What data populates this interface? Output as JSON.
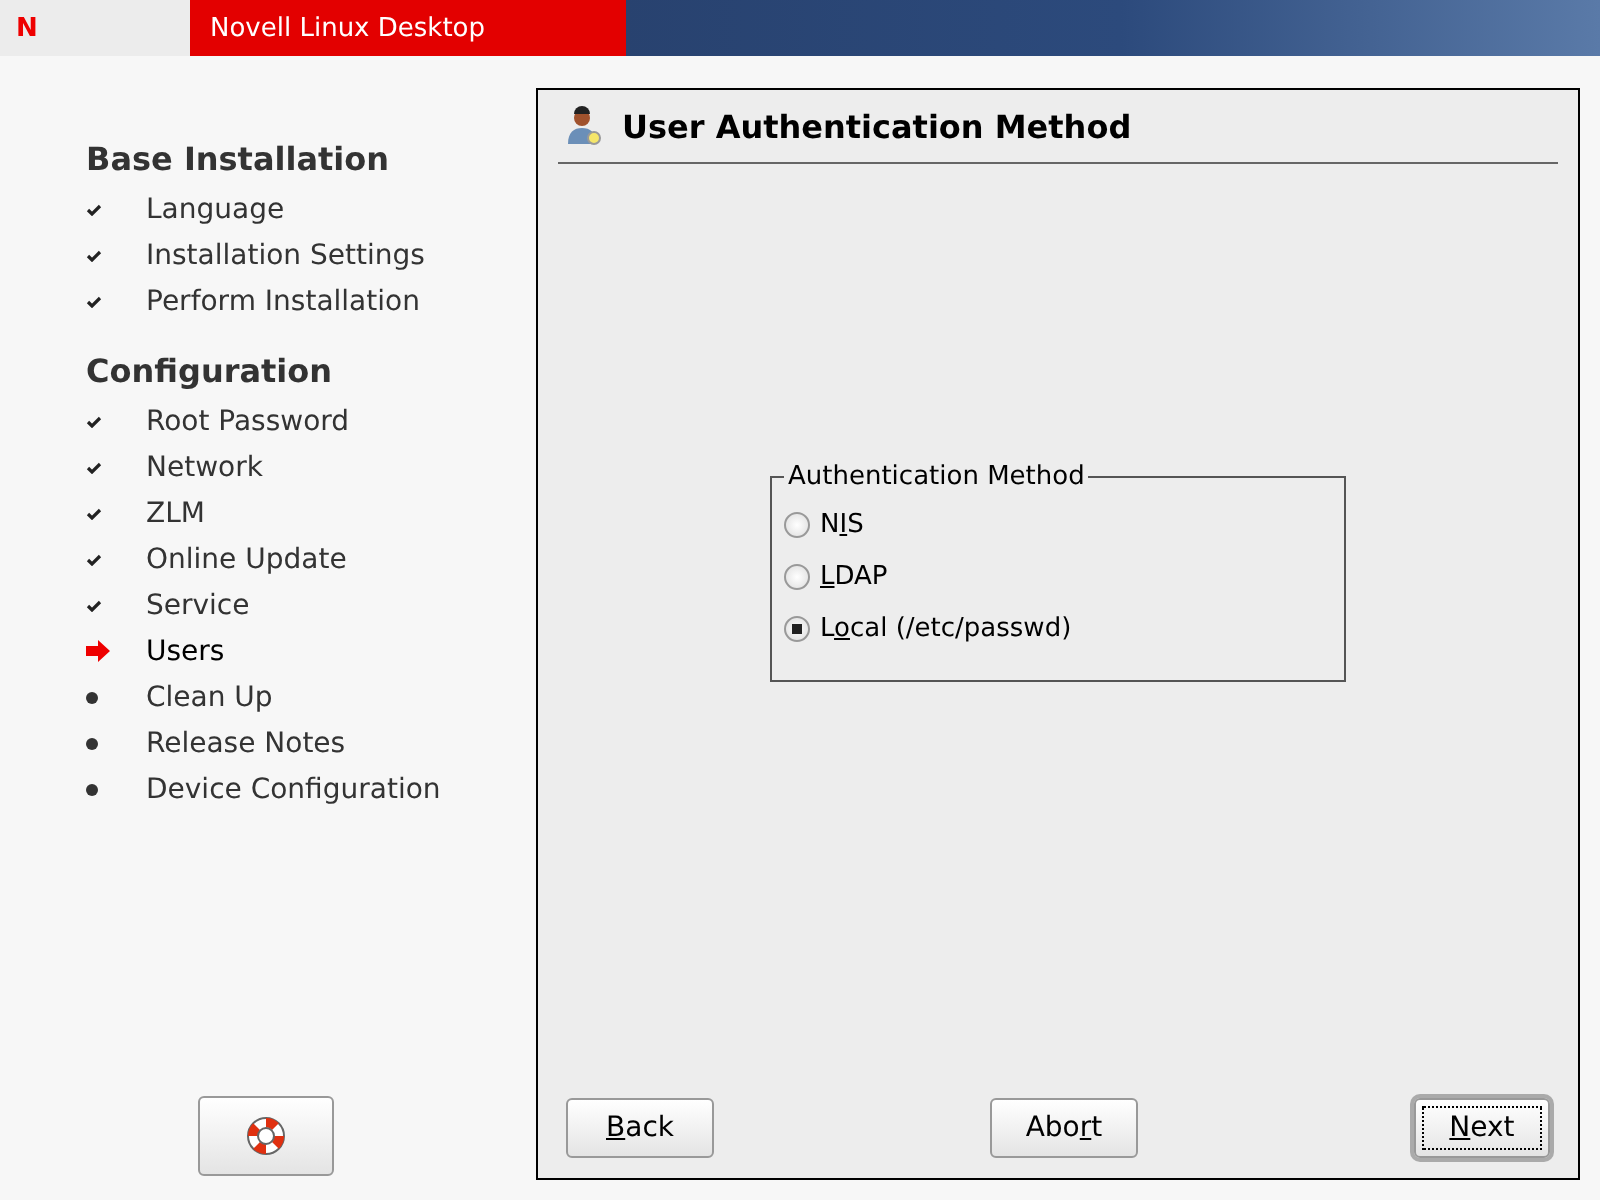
{
  "header": {
    "logo": "N",
    "title": "Novell Linux Desktop"
  },
  "sidebar": {
    "sections": [
      {
        "title": "Base Installation",
        "items": [
          {
            "label": "Language",
            "kind": "done"
          },
          {
            "label": "Installation Settings",
            "kind": "done"
          },
          {
            "label": "Perform Installation",
            "kind": "done"
          }
        ]
      },
      {
        "title": "Configuration",
        "items": [
          {
            "label": "Root Password",
            "kind": "done"
          },
          {
            "label": "Network",
            "kind": "done"
          },
          {
            "label": "ZLM",
            "kind": "done"
          },
          {
            "label": "Online Update",
            "kind": "done"
          },
          {
            "label": "Service",
            "kind": "done"
          },
          {
            "label": "Users",
            "kind": "current"
          },
          {
            "label": "Clean Up",
            "kind": "pending"
          },
          {
            "label": "Release Notes",
            "kind": "pending"
          },
          {
            "label": "Device Configuration",
            "kind": "pending"
          }
        ]
      }
    ]
  },
  "dialog": {
    "title": "User Authentication Method",
    "group": {
      "title": "Authentication Method",
      "options": [
        {
          "before": "N",
          "key": "I",
          "after": "S",
          "selected": false
        },
        {
          "key": "L",
          "after": "DAP",
          "selected": false
        },
        {
          "before": "L",
          "key": "o",
          "after": "cal (/etc/passwd)",
          "selected": true
        }
      ]
    },
    "buttons": [
      {
        "key": "B",
        "after": "ack",
        "default": false
      },
      {
        "before": "Abo",
        "key": "r",
        "after": "t",
        "default": false
      },
      {
        "key": "N",
        "after": "ext",
        "default": true
      }
    ]
  }
}
